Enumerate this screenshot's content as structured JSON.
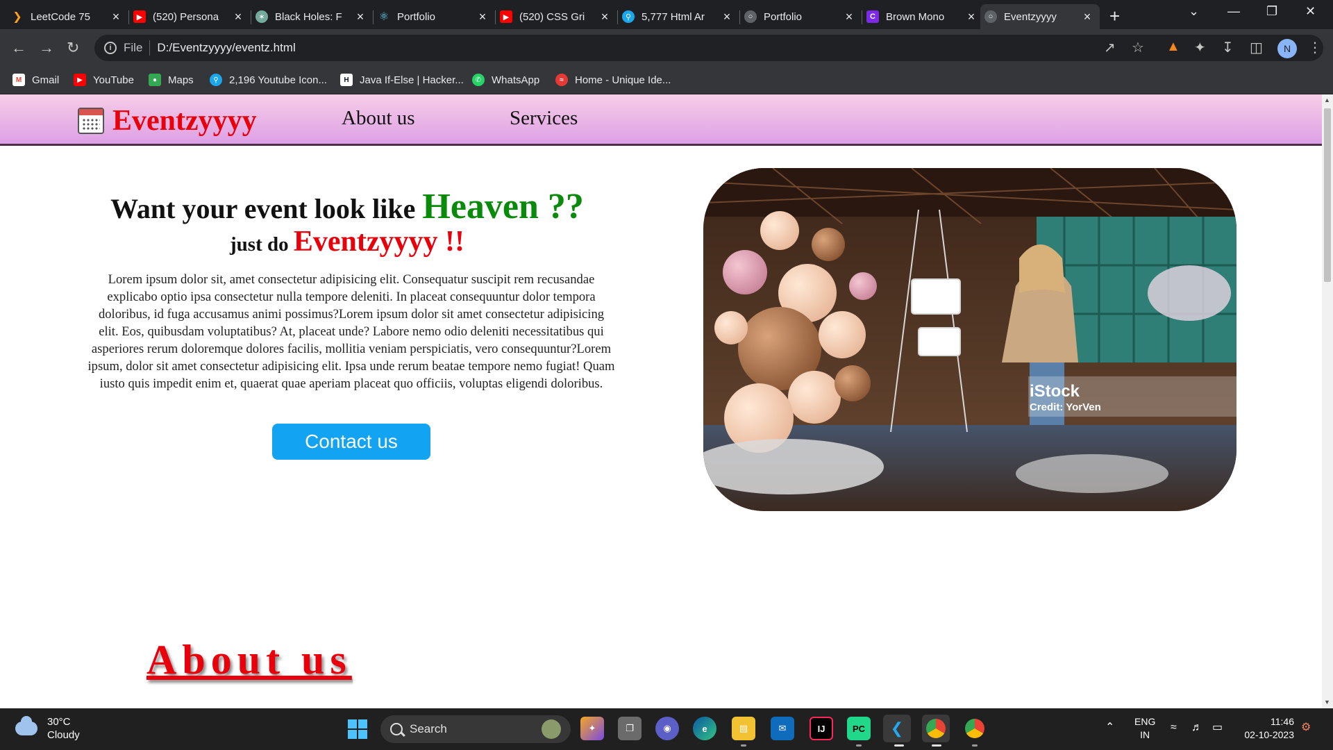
{
  "browser": {
    "tabs": [
      {
        "title": "LeetCode 75",
        "favicon": "leetcode-icon",
        "color": "#ffa116"
      },
      {
        "title": "(520) Persona",
        "favicon": "youtube-icon",
        "color": "#ff0000"
      },
      {
        "title": "Black Holes: F",
        "favicon": "chatgpt-icon",
        "color": "#74aa9c"
      },
      {
        "title": "Portfolio",
        "favicon": "react-icon",
        "color": "#61dafb"
      },
      {
        "title": "(520) CSS Gri",
        "favicon": "youtube-icon",
        "color": "#ff0000"
      },
      {
        "title": "5,777 Html Ar",
        "favicon": "search-icon",
        "color": "#1aa7ec"
      },
      {
        "title": "Portfolio",
        "favicon": "globe-icon",
        "color": "#9aa0a6"
      },
      {
        "title": "Brown Mono",
        "favicon": "canva-icon",
        "color": "#7d2ae8"
      },
      {
        "title": "Eventzyyyy",
        "favicon": "globe-icon",
        "color": "#9aa0a6",
        "active": true
      }
    ],
    "address": {
      "scheme_label": "File",
      "url": "D:/Eventzyyyy/eventz.html"
    },
    "profile_initial": "N",
    "bookmarks": [
      {
        "label": "Gmail",
        "icon": "gmail-icon",
        "color": "#ea4335"
      },
      {
        "label": "YouTube",
        "icon": "youtube-icon",
        "color": "#ff0000"
      },
      {
        "label": "Maps",
        "icon": "maps-icon",
        "color": "#34a853"
      },
      {
        "label": "2,196 Youtube Icon...",
        "icon": "search-icon",
        "color": "#1aa7ec"
      },
      {
        "label": "Java If-Else | Hacker...",
        "icon": "hackerrank-icon",
        "color": "#0e141e"
      },
      {
        "label": "WhatsApp",
        "icon": "whatsapp-icon",
        "color": "#25d366"
      },
      {
        "label": "Home - Unique Ide...",
        "icon": "wifi-logo-icon",
        "color": "#e53935"
      }
    ]
  },
  "site": {
    "brand": "Eventzyyyy",
    "nav": [
      "About us",
      "Services"
    ],
    "hero": {
      "line1_prefix": "Want your event look like ",
      "line1_accent": "Heaven ??",
      "line2_prefix": "just do ",
      "line2_accent": "Eventzyyyy !!",
      "paragraph": "Lorem ipsum dolor sit, amet consectetur adipisicing elit. Consequatur suscipit rem recusandae explicabo optio ipsa consectetur nulla tempore deleniti. In placeat consequuntur dolor tempora doloribus, id fuga accusamus animi possimus?Lorem ipsum dolor sit amet consectetur adipisicing elit. Eos, quibusdam voluptatibus? At, placeat unde? Labore nemo odio deleniti necessitatibus qui asperiores rerum doloremque dolores facilis, mollitia veniam perspiciatis, vero consequuntur?Lorem ipsum, dolor sit amet consectetur adipisicing elit. Ipsa unde rerum beatae tempore nemo fugiat! Quam iusto quis impedit enim et, quaerat quae aperiam placeat quo officiis, voluptas eligendi doloribus.",
      "cta": "Contact us",
      "image_watermark": "iStock",
      "image_credit": "Credit: YorVen"
    },
    "about_heading": "About us"
  },
  "taskbar": {
    "weather_temp": "30°C",
    "weather_desc": "Cloudy",
    "search_placeholder": "Search",
    "lang_top": "ENG",
    "lang_bottom": "IN",
    "time": "11:46",
    "date": "02-10-2023"
  }
}
